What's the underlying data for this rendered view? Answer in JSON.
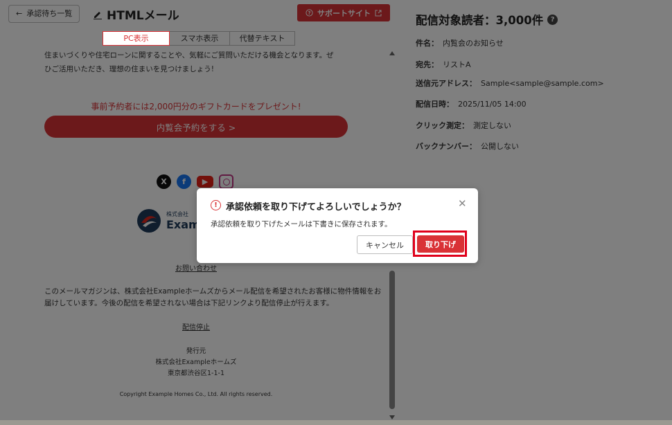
{
  "topbar": {
    "back_label": "承認待ち一覧",
    "title": "HTMLメール",
    "support_label": "サポートサイト"
  },
  "tabs": [
    {
      "label": "PC表示",
      "active": true
    },
    {
      "label": "スマホ表示",
      "active": false
    },
    {
      "label": "代替テキスト",
      "active": false
    }
  ],
  "preview": {
    "intro_line1": "住まいづくりや住宅ローンに関することや、気軽にご質問いただける機会となります。ぜ",
    "intro_line2": "ひご活用いただき、理想の住まいを見つけましょう!",
    "promo": "事前予約者には2,000円分のギフトカードをプレゼント!",
    "cta": "内覧会予約をする >",
    "logo_small": "株式会社",
    "logo_big": "Exam",
    "contact_link": "お問い合わせ",
    "notice_line1": "このメールマガジンは、株式会社Exampleホームズからメール配信を希望されたお客様に物件情報をお",
    "notice_line2": "届けしています。今後の配信を希望されない場合は下記リンクより配信停止が行えます。",
    "unsubscribe": "配信停止",
    "publisher_label": "発行元",
    "publisher_name": "株式会社Exampleホームズ",
    "address": "東京都渋谷区1-1-1",
    "copyright": "Copyright Example Homes Co., Ltd. All rights reserved."
  },
  "panel": {
    "title": "配信対象読者：3,000件",
    "rows": [
      {
        "key": "件名：",
        "value": "内覧会のお知らせ"
      },
      {
        "key": "宛先：",
        "value": "リストA"
      },
      {
        "key": "送信元アドレス：",
        "value": "Sample<sample@sample.com>"
      },
      {
        "key": "配信日時：",
        "value": "2025/11/05 14:00"
      },
      {
        "key": "クリック測定：",
        "value": "測定しない"
      },
      {
        "key": "バックナンバー：",
        "value": "公開しない"
      }
    ]
  },
  "dialog": {
    "title": "承認依頼を取り下げてよろしいでしょうか？",
    "message": "承認依頼を取り下げたメールは下書きに保存されます。",
    "cancel_label": "キャンセル",
    "confirm_label": "取り下げ"
  },
  "colors": {
    "brand_red": "#d93236",
    "overlay": "rgba(0,0,0,0.5)"
  },
  "icons": [
    "arrow-left-icon",
    "pen-icon",
    "question-icon",
    "external-link-icon",
    "warning-icon",
    "close-icon",
    "x-icon",
    "facebook-icon",
    "youtube-icon",
    "instagram-icon"
  ]
}
